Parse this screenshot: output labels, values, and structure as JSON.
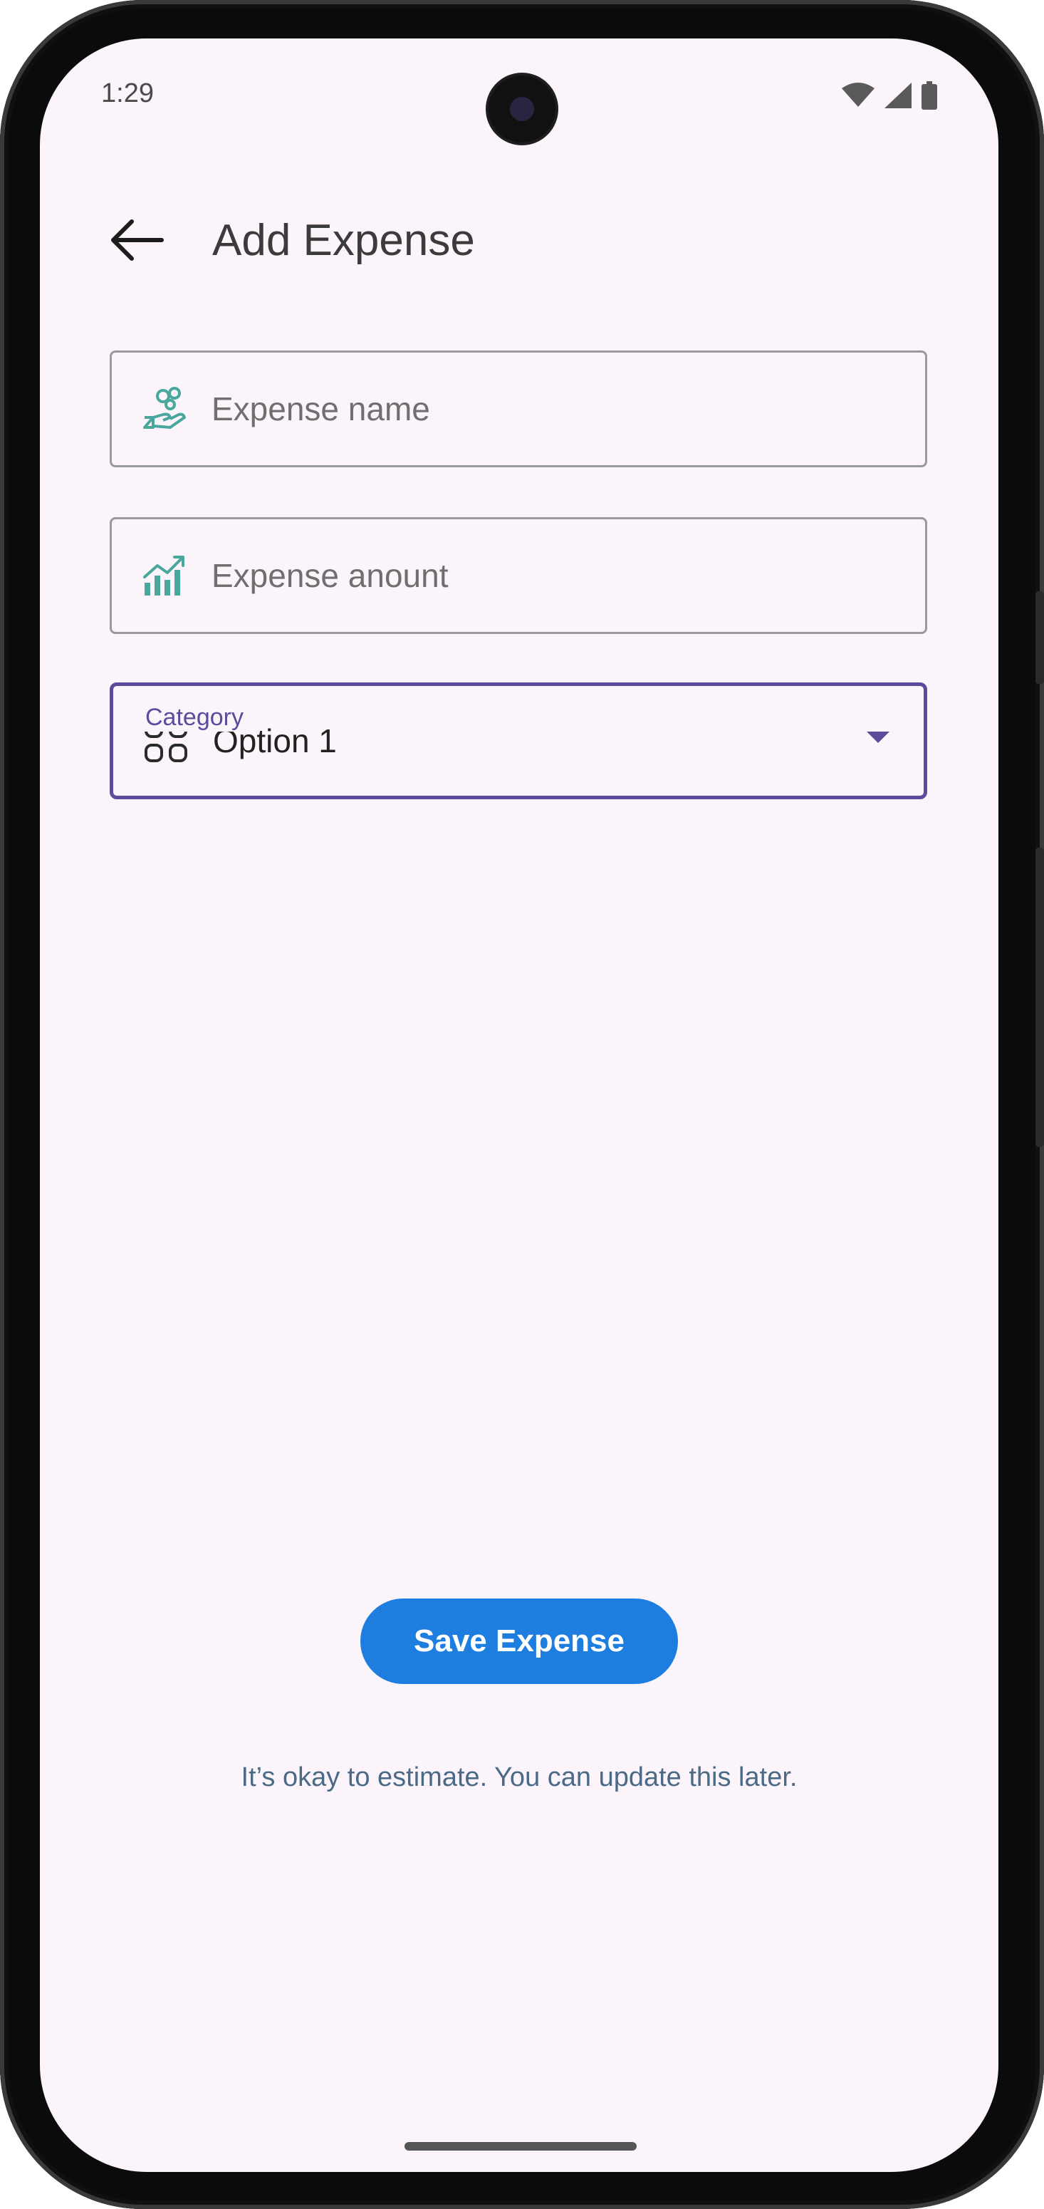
{
  "status_bar": {
    "time": "1:29",
    "icons": [
      "wifi-icon",
      "cell-signal-icon",
      "battery-icon"
    ]
  },
  "app_bar": {
    "back_icon": "arrow-back-icon",
    "title": "Add Expense"
  },
  "form": {
    "expense_name": {
      "icon": "money-hand-icon",
      "placeholder": "Expense name"
    },
    "expense_amount": {
      "icon": "chart-growth-icon",
      "placeholder": "Expense anount"
    },
    "category": {
      "label": "Category",
      "icon": "grid-icon",
      "selected": "Option 1",
      "caret_icon": "dropdown-arrow-icon"
    }
  },
  "actions": {
    "save_label": "Save Expense"
  },
  "hint": "It’s okay to estimate. You can update this later.",
  "colors": {
    "background": "#fcf4fb",
    "accent": "#5b4b9a",
    "button": "#1e7ee0",
    "icon_teal": "#4aa79d",
    "hint_text": "#4b6a86"
  }
}
